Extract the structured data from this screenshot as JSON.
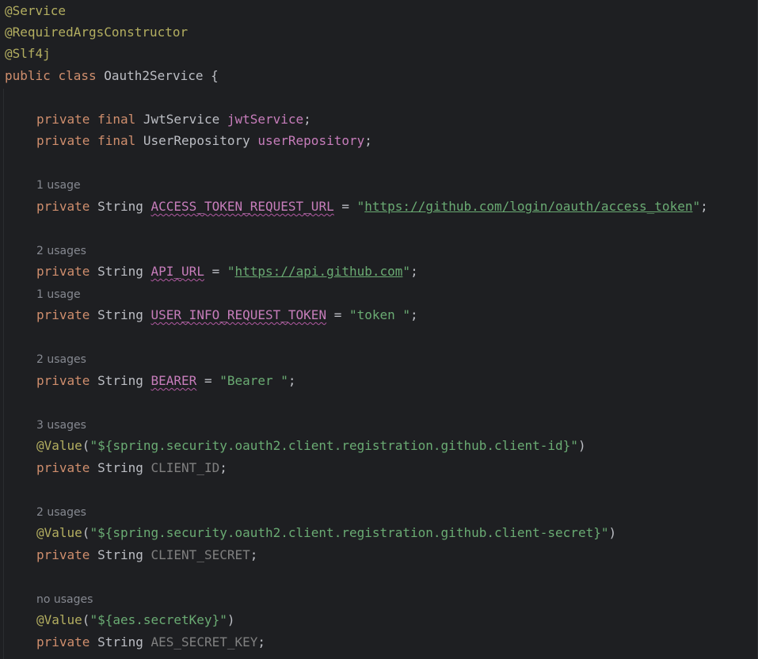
{
  "code": {
    "ann_service": "@Service",
    "ann_required": "@RequiredArgsConstructor",
    "ann_slf4j": "@Slf4j",
    "class_decl": {
      "public": "public",
      "class": "class",
      "name": " Oauth2Service {"
    },
    "kw_private": "private",
    "kw_final": "final",
    "type_string": "String",
    "jwt": {
      "type": " JwtService ",
      "name": "jwtService",
      "end": ";"
    },
    "user_repo": {
      "type": " UserRepository ",
      "name": "userRepository",
      "end": ";"
    },
    "access_token": {
      "usage": "1 usage",
      "name": "ACCESS_TOKEN_REQUEST_URL",
      "eq": " = ",
      "q1": "\"",
      "url": "https://github.com/login/oauth/access_token",
      "q2": "\"",
      "end": ";"
    },
    "api_url": {
      "usage": "2 usages",
      "name": "API_URL",
      "eq": " = ",
      "q1": "\"",
      "url": "https://api.github.com",
      "q2": "\"",
      "end": ";"
    },
    "user_info": {
      "usage": "1 usage",
      "name": "USER_INFO_REQUEST_TOKEN",
      "eq": " = ",
      "value": "\"token \"",
      "end": ";"
    },
    "bearer": {
      "usage": "2 usages",
      "name": "BEARER",
      "eq": " = ",
      "value": "\"Bearer \"",
      "end": ";"
    },
    "client_id": {
      "usage": "3 usages",
      "ann": "@Value",
      "open": "(",
      "value": "\"${spring.security.oauth2.client.registration.github.client-id}\"",
      "close": ")",
      "name": "CLIENT_ID",
      "end": ";"
    },
    "client_secret": {
      "usage": "2 usages",
      "ann": "@Value",
      "open": "(",
      "value": "\"${spring.security.oauth2.client.registration.github.client-secret}\"",
      "close": ")",
      "name": "CLIENT_SECRET",
      "end": ";"
    },
    "aes_key": {
      "usage": "no usages",
      "ann": "@Value",
      "open": "(",
      "value": "\"${aes.secretKey}\"",
      "close": ")",
      "name": "AES_SECRET_KEY",
      "end": ";"
    }
  },
  "colors": {
    "background": "#1e1f22",
    "keyword": "#cf8e6d",
    "annotation": "#b3ae60",
    "field": "#c77dbb",
    "string": "#6aab73",
    "unused": "#808080",
    "hint": "#868991",
    "text": "#bcbec4"
  }
}
